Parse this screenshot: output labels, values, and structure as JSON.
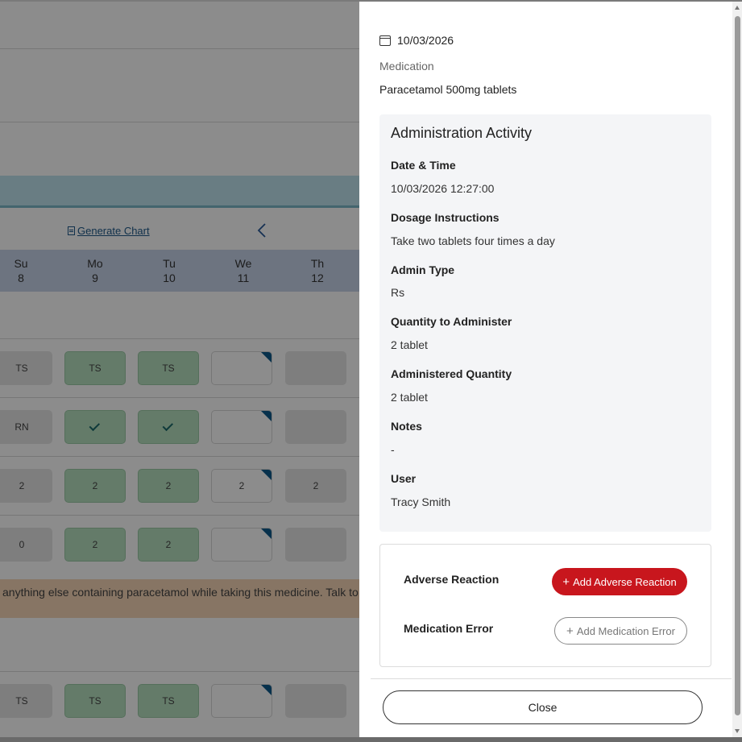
{
  "background": {
    "generate_chart_label": "Generate Chart",
    "days": [
      {
        "name": "Su",
        "num": "8"
      },
      {
        "name": "Mo",
        "num": "9"
      },
      {
        "name": "Tu",
        "num": "10"
      },
      {
        "name": "We",
        "num": "11"
      },
      {
        "name": "Th",
        "num": "12"
      }
    ],
    "rows": [
      [
        "TS",
        "TS",
        "TS",
        "",
        ""
      ],
      [
        "RN",
        "✓",
        "✓",
        "",
        ""
      ],
      [
        "2",
        "2",
        "2",
        "2",
        "2"
      ],
      [
        "0",
        "2",
        "2",
        "",
        ""
      ],
      [
        "TS",
        "TS",
        "TS",
        "",
        ""
      ]
    ],
    "warning_text": "anything else containing paracetamol while taking this medicine. Talk to"
  },
  "drawer": {
    "date": "10/03/2026",
    "medication_label": "Medication",
    "medication_name": "Paracetamol 500mg tablets",
    "activity": {
      "title": "Administration Activity",
      "fields": [
        {
          "label": "Date & Time",
          "value": "10/03/2026 12:27:00"
        },
        {
          "label": "Dosage Instructions",
          "value": "Take two tablets four times a day"
        },
        {
          "label": "Admin Type",
          "value": "Rs"
        },
        {
          "label": "Quantity to Administer",
          "value": "2 tablet"
        },
        {
          "label": "Administered Quantity",
          "value": "2 tablet"
        },
        {
          "label": "Notes",
          "value": "-"
        },
        {
          "label": "User",
          "value": "Tracy Smith"
        }
      ]
    },
    "actions": {
      "adverse_label": "Adverse Reaction",
      "adverse_button": "Add Adverse Reaction",
      "med_error_label": "Medication Error",
      "med_error_button": "Add Medication Error"
    },
    "close_button": "Close"
  },
  "colors": {
    "primary_red": "#c8161d",
    "cell_green": "#b7e0c0",
    "day_header": "#c7d4ea",
    "warning_bg": "#f6d6b6",
    "flag_blue": "#0d5a8a"
  },
  "icons": {
    "calendar": "calendar-icon",
    "document": "document-icon",
    "chevron": "chevron-left-icon",
    "plus": "plus-icon"
  }
}
